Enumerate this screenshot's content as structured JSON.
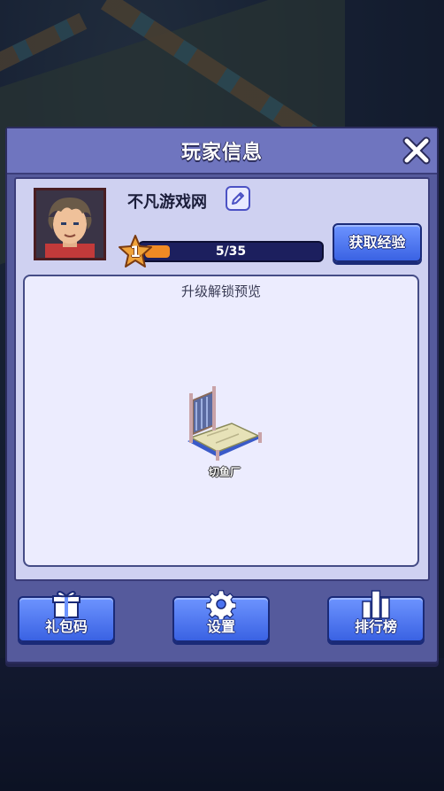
{
  "dialog": {
    "title": "玩家信息"
  },
  "player": {
    "name": "不凡游戏网",
    "level": "1",
    "xp_text": "5/35",
    "xp_progress": 0.143
  },
  "actions": {
    "get_exp_label": "获取经验"
  },
  "preview": {
    "title": "升级解锁预览",
    "items": [
      {
        "label": "切鱼厂",
        "icon": "fish-cutting-factory-icon"
      }
    ]
  },
  "bottom_buttons": {
    "gift_code": "礼包码",
    "settings": "设置",
    "ranking": "排行榜"
  },
  "colors": {
    "panel": "#555a9c",
    "title_bar": "#6f75bf",
    "content_bg": "#cfd1f1",
    "button_blue": "#4a73f0",
    "xp_fill": "#f08a24"
  }
}
